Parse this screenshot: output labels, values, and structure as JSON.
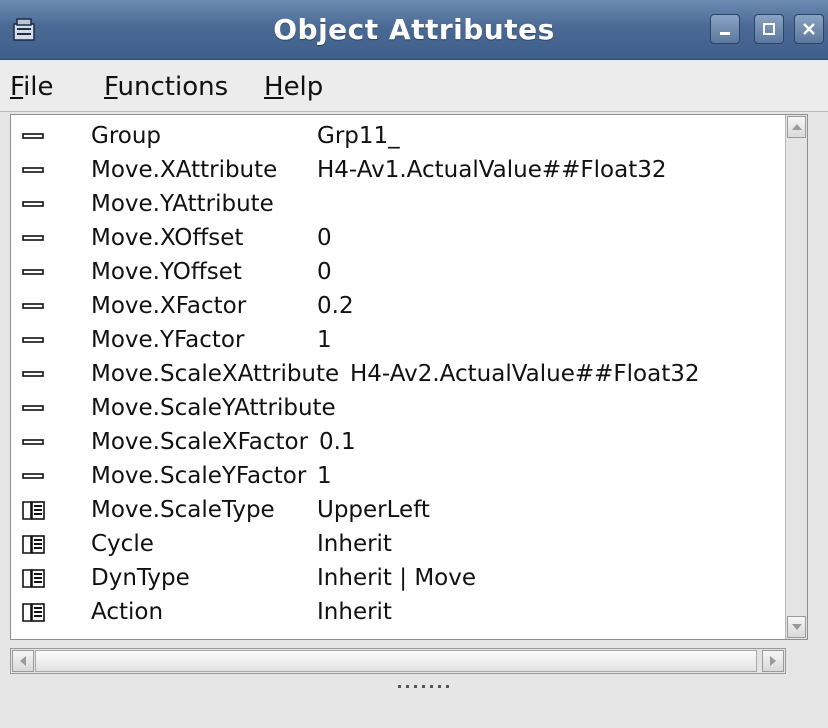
{
  "window": {
    "title": "Object Attributes"
  },
  "menu": {
    "file_label": "File",
    "file_mnemonic": "F",
    "file_rest": "ile",
    "functions_label": "Functions",
    "functions_mnemonic": "F",
    "functions_rest": "unctions",
    "help_label": "Help",
    "help_mnemonic": "H",
    "help_rest": "elp"
  },
  "attributes": [
    {
      "icon": "attribute-icon",
      "name": "Group",
      "value": "Grp11_"
    },
    {
      "icon": "attribute-icon",
      "name": "Move.XAttribute",
      "value": "H4-Av1.ActualValue##Float32"
    },
    {
      "icon": "attribute-icon",
      "name": "Move.YAttribute",
      "value": ""
    },
    {
      "icon": "attribute-icon",
      "name": "Move.XOffset",
      "value": "0"
    },
    {
      "icon": "attribute-icon",
      "name": "Move.YOffset",
      "value": "0"
    },
    {
      "icon": "attribute-icon",
      "name": "Move.XFactor",
      "value": "0.2"
    },
    {
      "icon": "attribute-icon",
      "name": "Move.YFactor",
      "value": "1"
    },
    {
      "icon": "attribute-icon",
      "name": "Move.ScaleXAttribute",
      "value": "H4-Av2.ActualValue##Float32"
    },
    {
      "icon": "attribute-icon",
      "name": "Move.ScaleYAttribute",
      "value": ""
    },
    {
      "icon": "attribute-icon",
      "name": "Move.ScaleXFactor",
      "value": "0.1"
    },
    {
      "icon": "attribute-icon",
      "name": "Move.ScaleYFactor",
      "value": "1"
    },
    {
      "icon": "folder-icon",
      "name": "Move.ScaleType",
      "value": "UpperLeft"
    },
    {
      "icon": "folder-icon",
      "name": "Cycle",
      "value": "Inherit"
    },
    {
      "icon": "folder-icon",
      "name": "DynType",
      "value": "Inherit | Move"
    },
    {
      "icon": "folder-icon",
      "name": "Action",
      "value": "Inherit"
    }
  ],
  "colors": {
    "titlebar": "#4a6a95",
    "background": "#e6e6e6",
    "list_background": "#ffffff"
  }
}
